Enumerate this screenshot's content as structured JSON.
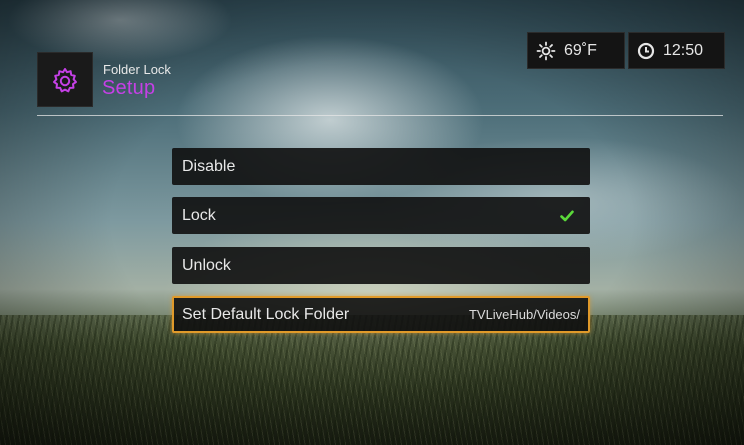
{
  "header": {
    "app_name": "Folder Lock",
    "page_title": "Setup",
    "app_icon": "gear-icon",
    "accent_color": "#c540e6"
  },
  "status": {
    "weather_icon": "sun-icon",
    "temperature": "69˚F",
    "clock_icon": "clock-icon",
    "time": "12:50"
  },
  "menu": {
    "items": [
      {
        "label": "Disable",
        "value": "",
        "checked": false,
        "selected": false
      },
      {
        "label": "Lock",
        "value": "",
        "checked": true,
        "selected": false
      },
      {
        "label": "Unlock",
        "value": "",
        "checked": false,
        "selected": false
      },
      {
        "label": "Set Default Lock Folder",
        "value": "TVLiveHub/Videos/",
        "checked": false,
        "selected": true
      }
    ],
    "check_icon": "checkmark-icon",
    "check_color": "#5bd93a",
    "selection_color": "#e09a2a"
  }
}
